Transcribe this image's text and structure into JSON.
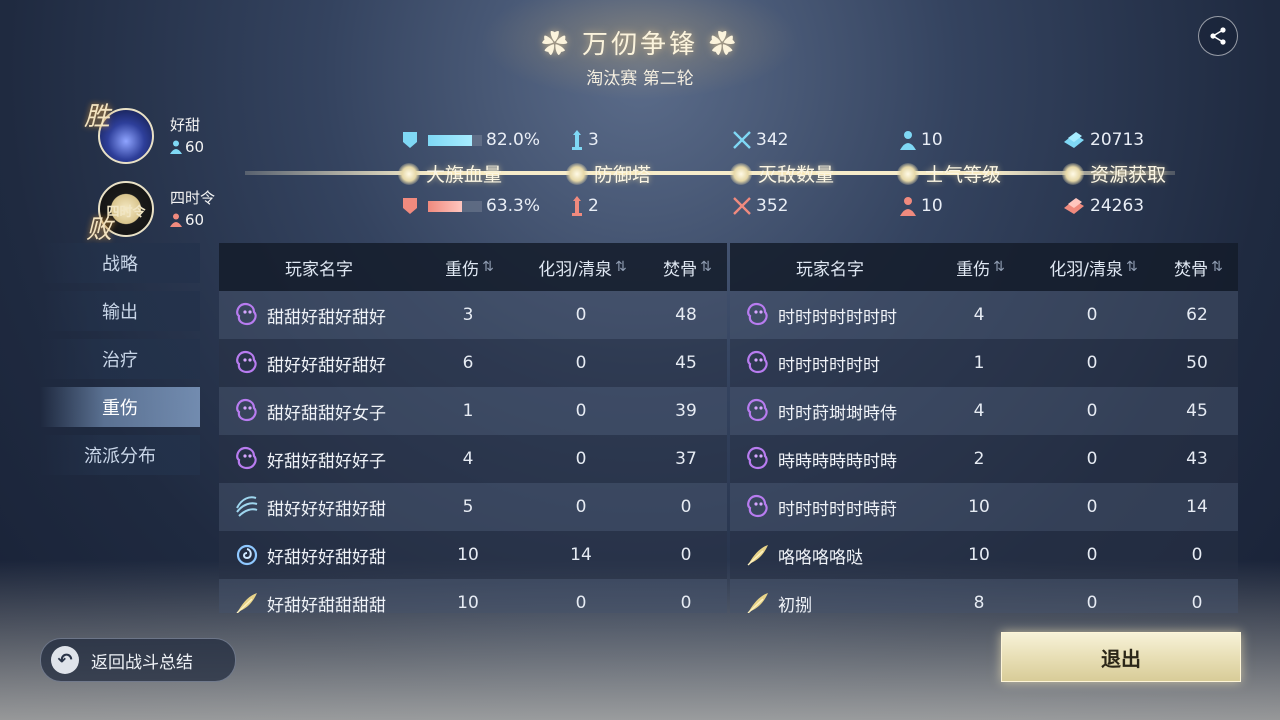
{
  "header": {
    "title": "✿ 万仞争锋 ✿",
    "subtitle": "淘汰赛 第二轮"
  },
  "teams": [
    {
      "result": "胜",
      "name": "好甜",
      "score": "60",
      "avatar_text": "",
      "color": "#7fd8f5"
    },
    {
      "result": "败",
      "name": "四时令",
      "score": "60",
      "avatar_text": "四时令",
      "color": "#f08a7e"
    }
  ],
  "stats": {
    "labels": [
      "大旗血量",
      "防御塔",
      "灭敌数量",
      "士气等级",
      "资源获取"
    ],
    "win": {
      "flag_hp": "82.0%",
      "tower": "3",
      "kills": "342",
      "morale": "10",
      "resource": "20713"
    },
    "lose": {
      "flag_hp": "63.3%",
      "tower": "2",
      "kills": "352",
      "morale": "10",
      "resource": "24263"
    },
    "win_flag_fill": 0.82,
    "lose_flag_fill": 0.633
  },
  "menu": [
    {
      "label": "战略",
      "active": false
    },
    {
      "label": "输出",
      "active": false
    },
    {
      "label": "治疗",
      "active": false
    },
    {
      "label": "重伤",
      "active": true
    },
    {
      "label": "流派分布",
      "active": false
    }
  ],
  "table": {
    "headers": [
      "玩家名字",
      "重伤",
      "化羽/清泉",
      "焚骨"
    ],
    "left_rows": [
      {
        "name": "甜甜好甜好甜好",
        "icon": "purple-ghost-icon",
        "a": "3",
        "b": "0",
        "c": "48"
      },
      {
        "name": "甜好好甜好甜好",
        "icon": "purple-ghost-icon",
        "a": "6",
        "b": "0",
        "c": "45"
      },
      {
        "name": "甜好甜甜好女子",
        "icon": "purple-ghost-icon",
        "a": "1",
        "b": "0",
        "c": "39"
      },
      {
        "name": "好甜好甜好好子",
        "icon": "purple-ghost-icon",
        "a": "4",
        "b": "0",
        "c": "37"
      },
      {
        "name": "甜好好好甜好甜",
        "icon": "blue-wave-icon",
        "a": "5",
        "b": "0",
        "c": "0"
      },
      {
        "name": "好甜好好甜好甜",
        "icon": "blue-swirl-icon",
        "a": "10",
        "b": "14",
        "c": "0"
      },
      {
        "name": "好甜好甜甜甜甜",
        "icon": "gold-feather-icon",
        "a": "10",
        "b": "0",
        "c": "0"
      }
    ],
    "right_rows": [
      {
        "name": "时时时时时时时",
        "icon": "purple-ghost-icon",
        "a": "4",
        "b": "0",
        "c": "62"
      },
      {
        "name": "时时时时时时",
        "icon": "purple-ghost-icon",
        "a": "1",
        "b": "0",
        "c": "50"
      },
      {
        "name": "时时莳埘埘時侍",
        "icon": "purple-ghost-icon",
        "a": "4",
        "b": "0",
        "c": "45"
      },
      {
        "name": "時時時時時时時",
        "icon": "purple-ghost-icon",
        "a": "2",
        "b": "0",
        "c": "43"
      },
      {
        "name": "时时时时时時莳",
        "icon": "purple-ghost-icon",
        "a": "10",
        "b": "0",
        "c": "14"
      },
      {
        "name": "咯咯咯咯哒",
        "icon": "gold-feather-icon",
        "a": "10",
        "b": "0",
        "c": "0"
      },
      {
        "name": "初捌",
        "icon": "gold-feather-icon",
        "a": "8",
        "b": "0",
        "c": "0"
      }
    ]
  },
  "buttons": {
    "back": "返回战斗总结",
    "exit": "退出"
  }
}
